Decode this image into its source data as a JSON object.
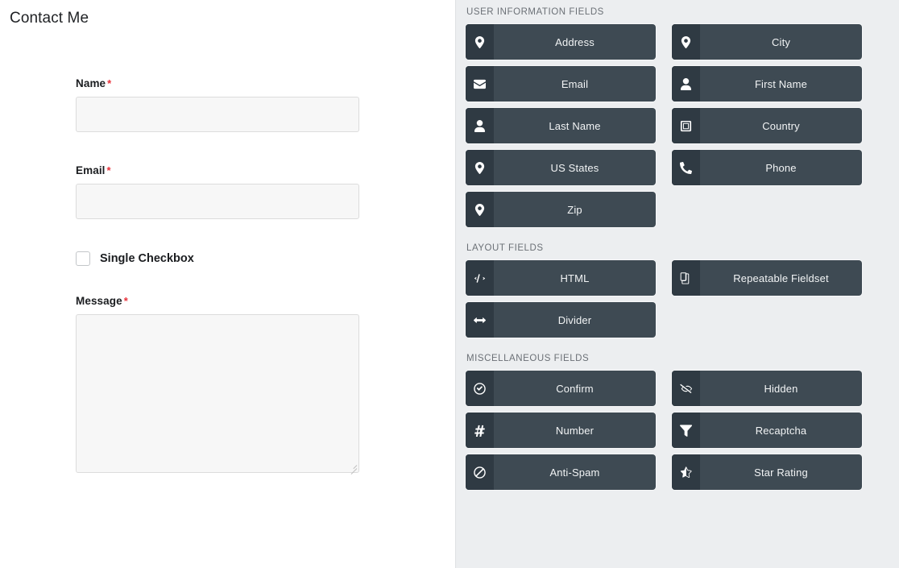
{
  "form": {
    "title": "Contact Me",
    "required_mark": "*",
    "fields": [
      {
        "label": "Name",
        "required": true,
        "type": "text",
        "value": "",
        "placeholder": ""
      },
      {
        "label": "Email",
        "required": true,
        "type": "text",
        "value": "",
        "placeholder": ""
      },
      {
        "label": "Single Checkbox",
        "required": false,
        "type": "checkbox",
        "checked": false
      },
      {
        "label": "Message",
        "required": true,
        "type": "textarea",
        "value": "",
        "placeholder": ""
      }
    ]
  },
  "palette": {
    "sections": [
      {
        "title": "USER INFORMATION FIELDS",
        "items": [
          {
            "label": "Address",
            "icon": "map-pin-icon"
          },
          {
            "label": "City",
            "icon": "map-pin-icon"
          },
          {
            "label": "Email",
            "icon": "envelope-icon"
          },
          {
            "label": "First Name",
            "icon": "user-icon"
          },
          {
            "label": "Last Name",
            "icon": "user-icon"
          },
          {
            "label": "Country",
            "icon": "flag-square-icon"
          },
          {
            "label": "US States",
            "icon": "map-pin-icon"
          },
          {
            "label": "Phone",
            "icon": "phone-icon"
          },
          {
            "label": "Zip",
            "icon": "map-pin-icon"
          }
        ]
      },
      {
        "title": "LAYOUT FIELDS",
        "items": [
          {
            "label": "HTML",
            "icon": "code-icon"
          },
          {
            "label": "Repeatable Fieldset",
            "icon": "copy-icon"
          },
          {
            "label": "Divider",
            "icon": "arrows-left-right-icon"
          }
        ]
      },
      {
        "title": "MISCELLANEOUS FIELDS",
        "items": [
          {
            "label": "Confirm",
            "icon": "check-circle-icon"
          },
          {
            "label": "Hidden",
            "icon": "eye-slash-icon"
          },
          {
            "label": "Number",
            "icon": "hashtag-icon"
          },
          {
            "label": "Recaptcha",
            "icon": "filter-icon"
          },
          {
            "label": "Anti-Spam",
            "icon": "ban-icon"
          },
          {
            "label": "Star Rating",
            "icon": "star-half-icon"
          }
        ]
      }
    ]
  },
  "colors": {
    "button_bg": "#3e4a53",
    "button_icon_bg": "#2f3a43",
    "panel_bg": "#eceef0",
    "required_asterisk": "#e8313a",
    "input_bg": "#f7f7f7",
    "section_title": "#6b7076"
  }
}
